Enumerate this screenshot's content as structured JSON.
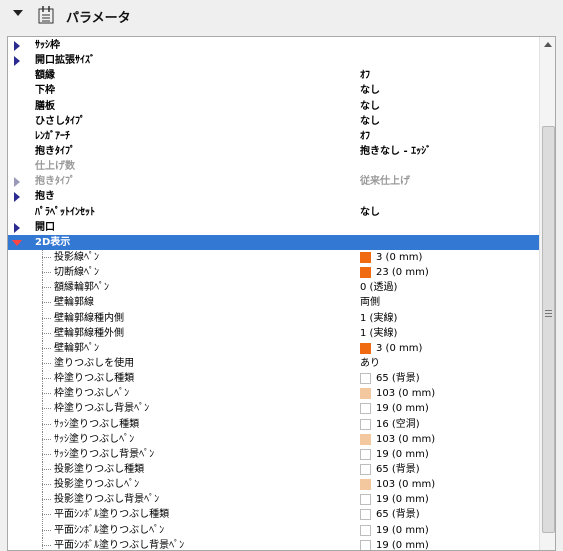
{
  "header": {
    "title": "パラメータ"
  },
  "rows": [
    {
      "kind": "group",
      "expand": "right",
      "label": "ｻｯｼ枠",
      "value": ""
    },
    {
      "kind": "group",
      "expand": "right",
      "label": "開口拡張ｻｲｽﾞ",
      "value": ""
    },
    {
      "kind": "prop",
      "label": "額縁",
      "value": "ｵﾌ"
    },
    {
      "kind": "prop",
      "label": "下枠",
      "value": "なし"
    },
    {
      "kind": "prop",
      "label": "膳板",
      "value": "なし"
    },
    {
      "kind": "prop",
      "label": "ひさしﾀｲﾌﾟ",
      "value": "なし"
    },
    {
      "kind": "prop",
      "label": "ﾚﾝｶﾞｱｰﾁ",
      "value": "ｵﾌ"
    },
    {
      "kind": "prop",
      "label": "抱きﾀｲﾌﾟ",
      "value": "抱きなし - ｴｯｼﾞ"
    },
    {
      "kind": "prop",
      "disabled": true,
      "label": "仕上げ数",
      "value": ""
    },
    {
      "kind": "group",
      "expand": "right",
      "disabled": true,
      "label": "抱きﾀｲﾌﾟ",
      "value": "従来仕上げ"
    },
    {
      "kind": "group",
      "expand": "right",
      "label": "抱き",
      "value": ""
    },
    {
      "kind": "prop",
      "label": "ﾊﾟﾗﾍﾟｯﾄｲﾝｾｯﾄ",
      "value": "なし"
    },
    {
      "kind": "group",
      "expand": "right",
      "label": "開口",
      "value": ""
    },
    {
      "kind": "group",
      "expand": "down",
      "selected": true,
      "label": "2D表示",
      "value": ""
    },
    {
      "kind": "child",
      "label": "投影線ﾍﾟﾝ",
      "swatch": "#f06a12",
      "value": "3 (0 mm)"
    },
    {
      "kind": "child",
      "label": "切断線ﾍﾟﾝ",
      "swatch": "#f06a12",
      "value": "23 (0 mm)"
    },
    {
      "kind": "child",
      "label": "額縁輪郭ﾍﾟﾝ",
      "value": "0 (透過)"
    },
    {
      "kind": "child",
      "label": "壁輪郭線",
      "value": "両側"
    },
    {
      "kind": "child",
      "label": "壁輪郭線種内側",
      "value": "1 (実線)"
    },
    {
      "kind": "child",
      "label": "壁輪郭線種外側",
      "value": "1 (実線)"
    },
    {
      "kind": "child",
      "label": "壁輪郭ﾍﾟﾝ",
      "swatch": "#f06a12",
      "value": "3 (0 mm)"
    },
    {
      "kind": "child",
      "label": "塗りつぶしを使用",
      "value": "あり"
    },
    {
      "kind": "child",
      "label": "枠塗りつぶし種類",
      "swatch": "#ffffff",
      "value": "65 (背景)"
    },
    {
      "kind": "child",
      "label": "枠塗りつぶしﾍﾟﾝ",
      "swatch": "#f4c89f",
      "value": "103 (0 mm)"
    },
    {
      "kind": "child",
      "label": "枠塗りつぶし背景ﾍﾟﾝ",
      "swatch": "#ffffff",
      "value": "19 (0 mm)"
    },
    {
      "kind": "child",
      "label": "ｻｯｼ塗りつぶし種類",
      "swatch": "#ffffff",
      "value": "16 (空洞)"
    },
    {
      "kind": "child",
      "label": "ｻｯｼ塗りつぶしﾍﾟﾝ",
      "swatch": "#f4c89f",
      "value": "103 (0 mm)"
    },
    {
      "kind": "child",
      "label": "ｻｯｼ塗りつぶし背景ﾍﾟﾝ",
      "swatch": "#ffffff",
      "value": "19 (0 mm)"
    },
    {
      "kind": "child",
      "label": "投影塗りつぶし種類",
      "swatch": "#ffffff",
      "value": "65 (背景)"
    },
    {
      "kind": "child",
      "label": "投影塗りつぶしﾍﾟﾝ",
      "swatch": "#f4c89f",
      "value": "103 (0 mm)"
    },
    {
      "kind": "child",
      "label": "投影塗りつぶし背景ﾍﾟﾝ",
      "swatch": "#ffffff",
      "value": "19 (0 mm)"
    },
    {
      "kind": "child",
      "label": "平面ｼﾝﾎﾞﾙ塗りつぶし種類",
      "swatch": "#ffffff",
      "value": "65 (背景)"
    },
    {
      "kind": "child",
      "label": "平面ｼﾝﾎﾞﾙ塗りつぶしﾍﾟﾝ",
      "swatch": "#ffffff",
      "value": "19 (0 mm)"
    },
    {
      "kind": "child",
      "label": "平面ｼﾝﾎﾞﾙ塗りつぶし背景ﾍﾟﾝ",
      "swatch": "#ffffff",
      "value": "19 (0 mm)"
    }
  ],
  "colors": {
    "selection": "#3378d3",
    "pen_orange": "#f06a12",
    "fill_peach": "#f4c89f"
  }
}
